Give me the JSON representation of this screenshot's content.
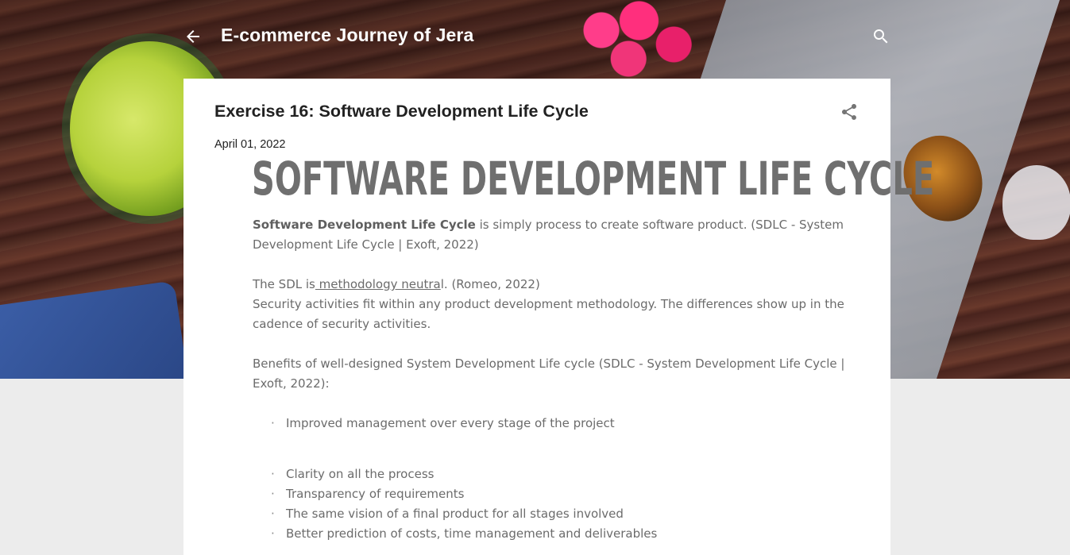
{
  "header": {
    "blog_title": "E-commerce Journey of Jera",
    "back_icon": "arrow-back-icon",
    "search_icon": "search-icon"
  },
  "post": {
    "title": "Exercise 16: Software Development Life Cycle",
    "date": "April 01, 2022",
    "share_icon": "share-icon",
    "heading": "SOFTWARE DEVELOPMENT LIFE CYCLE",
    "p1_bold": "Software Development Life Cycle",
    "p1_rest": " is simply process to create software product. (SDLC - System Development Life Cycle | Exoft, 2022)",
    "p2_prefix": "The SDL is",
    "p2_link": " methodology neutra",
    "p2_suffix": "l. (Romeo, 2022)",
    "p2_line2": "Security activities fit within any product development methodology. The differences show up in the cadence of security activities.",
    "p3": "Benefits of well-designed System Development Life cycle (SDLC - System Development Life Cycle | Exoft, 2022):",
    "bullet_char": "·",
    "bullets": [
      "Improved management over every stage of the project",
      "Clarity on all the process",
      "Transparency of requirements",
      "The same vision of a final product for all stages involved",
      "Better prediction of costs, time management and deliverables"
    ]
  },
  "colors": {
    "card_background": "#ffffff",
    "page_background": "#ececec",
    "title_text": "#212121",
    "body_text": "#6b6b6b",
    "heading_text": "#6f6f6f"
  }
}
